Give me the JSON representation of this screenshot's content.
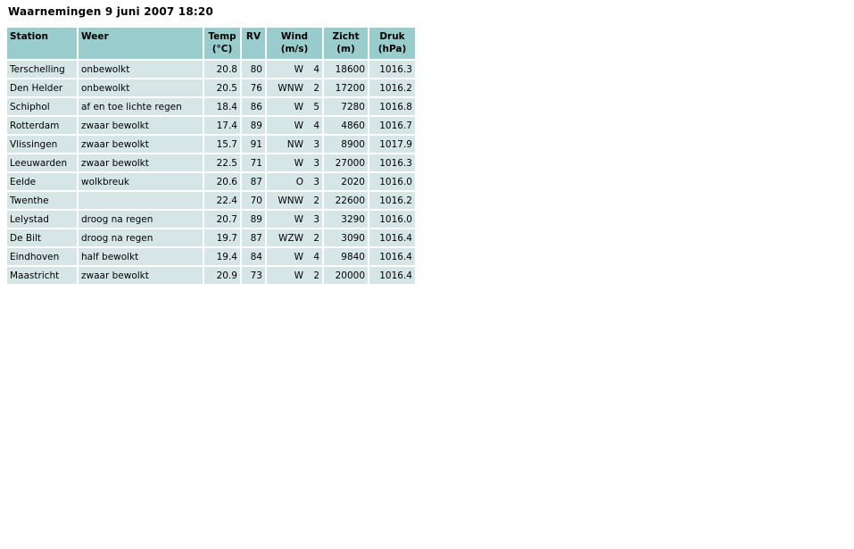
{
  "page": {
    "title": "Waarnemingen 9 juni 2007 18:20"
  },
  "table": {
    "headers": {
      "station": "Station",
      "weer": "Weer",
      "temp_line1": "Temp",
      "temp_line2": "(°C)",
      "rv": "RV",
      "wind_line1": "Wind",
      "wind_line2": "(m/s)",
      "zicht_line1": "Zicht",
      "zicht_line2": "(m)",
      "druk_line1": "Druk",
      "druk_line2": "(hPa)"
    },
    "rows": [
      {
        "station": "Terschelling",
        "weer": "onbewolkt",
        "temp": "20.8",
        "rv": "80",
        "wind_dir": "W",
        "wind_speed": "4",
        "zicht": "18600",
        "druk": "1016.3"
      },
      {
        "station": "Den Helder",
        "weer": "onbewolkt",
        "temp": "20.5",
        "rv": "76",
        "wind_dir": "WNW",
        "wind_speed": "2",
        "zicht": "17200",
        "druk": "1016.2"
      },
      {
        "station": "Schiphol",
        "weer": "af en toe lichte regen",
        "temp": "18.4",
        "rv": "86",
        "wind_dir": "W",
        "wind_speed": "5",
        "zicht": "7280",
        "druk": "1016.8"
      },
      {
        "station": "Rotterdam",
        "weer": "zwaar bewolkt",
        "temp": "17.4",
        "rv": "89",
        "wind_dir": "W",
        "wind_speed": "4",
        "zicht": "4860",
        "druk": "1016.7"
      },
      {
        "station": "Vlissingen",
        "weer": "zwaar bewolkt",
        "temp": "15.7",
        "rv": "91",
        "wind_dir": "NW",
        "wind_speed": "3",
        "zicht": "8900",
        "druk": "1017.9"
      },
      {
        "station": "Leeuwarden",
        "weer": "zwaar bewolkt",
        "temp": "22.5",
        "rv": "71",
        "wind_dir": "W",
        "wind_speed": "3",
        "zicht": "27000",
        "druk": "1016.3"
      },
      {
        "station": "Eelde",
        "weer": "wolkbreuk",
        "temp": "20.6",
        "rv": "87",
        "wind_dir": "O",
        "wind_speed": "3",
        "zicht": "2020",
        "druk": "1016.0"
      },
      {
        "station": "Twenthe",
        "weer": "",
        "temp": "22.4",
        "rv": "70",
        "wind_dir": "WNW",
        "wind_speed": "2",
        "zicht": "22600",
        "druk": "1016.2"
      },
      {
        "station": "Lelystad",
        "weer": "droog na regen",
        "temp": "20.7",
        "rv": "89",
        "wind_dir": "W",
        "wind_speed": "3",
        "zicht": "3290",
        "druk": "1016.0"
      },
      {
        "station": "De Bilt",
        "weer": "droog na regen",
        "temp": "19.7",
        "rv": "87",
        "wind_dir": "WZW",
        "wind_speed": "2",
        "zicht": "3090",
        "druk": "1016.4"
      },
      {
        "station": "Eindhoven",
        "weer": "half bewolkt",
        "temp": "19.4",
        "rv": "84",
        "wind_dir": "W",
        "wind_speed": "4",
        "zicht": "9840",
        "druk": "1016.4"
      },
      {
        "station": "Maastricht",
        "weer": "zwaar bewolkt",
        "temp": "20.9",
        "rv": "73",
        "wind_dir": "W",
        "wind_speed": "2",
        "zicht": "20000",
        "druk": "1016.4"
      }
    ]
  },
  "colors": {
    "header_bg": "#99cccc",
    "cell_bg": "#d6e6e6",
    "page_bg": "#ffffff"
  }
}
